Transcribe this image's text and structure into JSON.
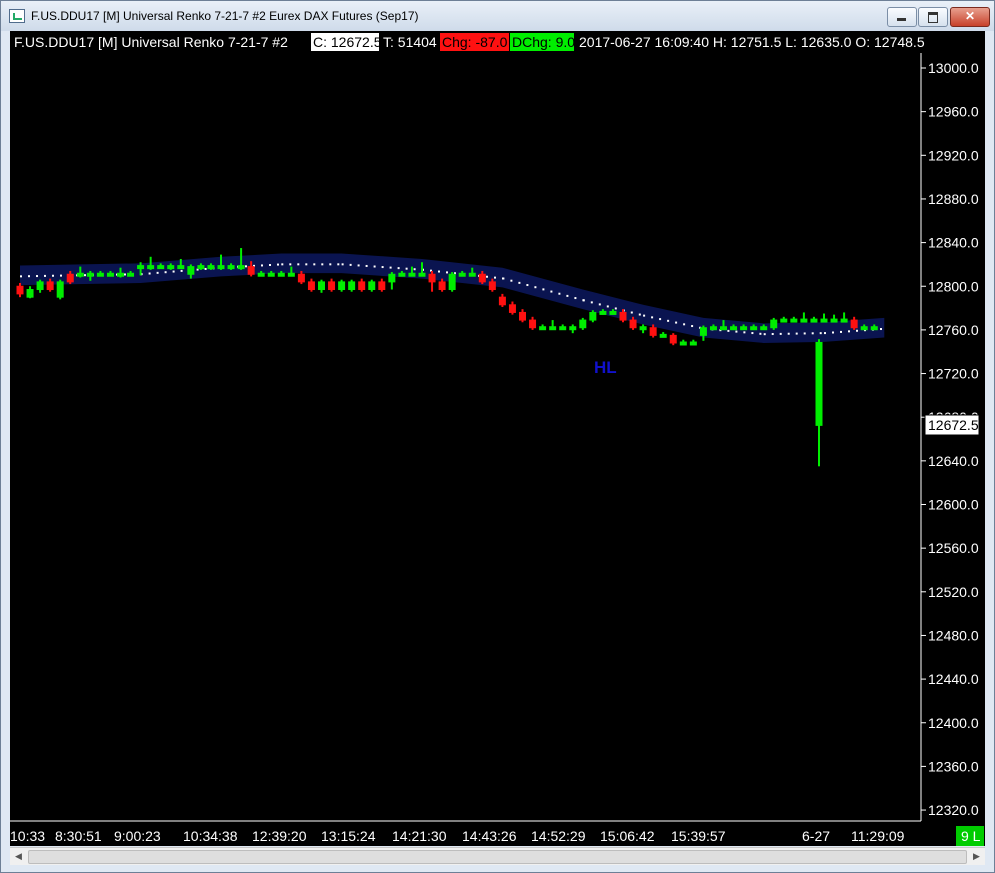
{
  "window": {
    "title": "F.US.DDU17 [M]  Universal Renko 7-21-7  #2  Eurex DAX Futures (Sep17)"
  },
  "header": {
    "symbol": "F.US.DDU17 [M]  Universal Renko 7-21-7  #2",
    "close": "C: 12672.5",
    "ticks": "T: 51404",
    "chg": "Chg: -87.0",
    "dchg": "DChg: 9.0",
    "ohlc": "2017-06-27 16:09:40 H: 12751.5 L: 12635.0 O: 12748.5"
  },
  "colors": {
    "background": "#000000",
    "up_bar": "#00ee00",
    "down_bar": "#ff1111",
    "band": "#0a1450",
    "band_dots": "#ffffff",
    "annotation": "#1111cc",
    "close_flag": "#00cc00"
  },
  "status": {
    "bar_count": "9 L"
  },
  "chart_data": {
    "type": "candlestick",
    "title": "",
    "ylim": [
      12300,
      13030
    ],
    "y_ticks": [
      "13000.0",
      "12960.0",
      "12920.0",
      "12880.0",
      "12840.0",
      "12800.0",
      "12760.0",
      "12720.0",
      "12680.0",
      "12640.0",
      "12600.0",
      "12560.0",
      "12520.0",
      "12480.0",
      "12440.0",
      "12400.0",
      "12360.0",
      "12320.0"
    ],
    "x_ticks": [
      "10:33",
      "8:30:51",
      "9:00:23",
      "10:34:38",
      "12:39:20",
      "13:15:24",
      "14:21:30",
      "14:43:26",
      "14:52:29",
      "15:06:42",
      "15:39:57",
      "6-27",
      "11:29:09"
    ],
    "current_price_label": "12672.5",
    "annotation": "HL",
    "grid": false,
    "bars": [
      {
        "o": 12800,
        "c": 12793,
        "h": 12803,
        "l": 12790
      },
      {
        "o": 12790,
        "c": 12797,
        "h": 12800,
        "l": 12789
      },
      {
        "o": 12797,
        "c": 12804,
        "h": 12806,
        "l": 12794
      },
      {
        "o": 12804,
        "c": 12797,
        "h": 12807,
        "l": 12795
      },
      {
        "o": 12790,
        "c": 12804,
        "h": 12806,
        "l": 12788
      },
      {
        "o": 12811,
        "c": 12804,
        "h": 12814,
        "l": 12802
      },
      {
        "o": 12811,
        "c": 12811,
        "h": 12818,
        "l": 12808
      },
      {
        "o": 12811,
        "c": 12811,
        "h": 12814,
        "l": 12805
      },
      {
        "o": 12811,
        "c": 12811,
        "h": 12814,
        "l": 12809
      },
      {
        "o": 12811,
        "c": 12811,
        "h": 12814,
        "l": 12809
      },
      {
        "o": 12811,
        "c": 12811,
        "h": 12817,
        "l": 12808
      },
      {
        "o": 12811,
        "c": 12811,
        "h": 12814,
        "l": 12809
      },
      {
        "o": 12818,
        "c": 12818,
        "h": 12822,
        "l": 12810
      },
      {
        "o": 12818,
        "c": 12818,
        "h": 12827,
        "l": 12815
      },
      {
        "o": 12818,
        "c": 12818,
        "h": 12821,
        "l": 12816
      },
      {
        "o": 12818,
        "c": 12818,
        "h": 12821,
        "l": 12815
      },
      {
        "o": 12818,
        "c": 12818,
        "h": 12825,
        "l": 12816
      },
      {
        "o": 12811,
        "c": 12818,
        "h": 12820,
        "l": 12807
      },
      {
        "o": 12818,
        "c": 12818,
        "h": 12821,
        "l": 12815
      },
      {
        "o": 12818,
        "c": 12818,
        "h": 12821,
        "l": 12815
      },
      {
        "o": 12818,
        "c": 12818,
        "h": 12829,
        "l": 12815
      },
      {
        "o": 12818,
        "c": 12818,
        "h": 12821,
        "l": 12815
      },
      {
        "o": 12818,
        "c": 12818,
        "h": 12835,
        "l": 12815
      },
      {
        "o": 12818,
        "c": 12811,
        "h": 12823,
        "l": 12809
      },
      {
        "o": 12811,
        "c": 12811,
        "h": 12814,
        "l": 12809
      },
      {
        "o": 12811,
        "c": 12811,
        "h": 12814,
        "l": 12809
      },
      {
        "o": 12811,
        "c": 12811,
        "h": 12814,
        "l": 12809
      },
      {
        "o": 12811,
        "c": 12811,
        "h": 12818,
        "l": 12809
      },
      {
        "o": 12811,
        "c": 12804,
        "h": 12814,
        "l": 12802
      },
      {
        "o": 12804,
        "c": 12797,
        "h": 12807,
        "l": 12795
      },
      {
        "o": 12797,
        "c": 12804,
        "h": 12806,
        "l": 12794
      },
      {
        "o": 12804,
        "c": 12797,
        "h": 12807,
        "l": 12795
      },
      {
        "o": 12797,
        "c": 12804,
        "h": 12806,
        "l": 12795
      },
      {
        "o": 12797,
        "c": 12804,
        "h": 12806,
        "l": 12795
      },
      {
        "o": 12804,
        "c": 12797,
        "h": 12807,
        "l": 12795
      },
      {
        "o": 12797,
        "c": 12804,
        "h": 12806,
        "l": 12795
      },
      {
        "o": 12804,
        "c": 12797,
        "h": 12807,
        "l": 12795
      },
      {
        "o": 12804,
        "c": 12811,
        "h": 12813,
        "l": 12797
      },
      {
        "o": 12811,
        "c": 12811,
        "h": 12814,
        "l": 12809
      },
      {
        "o": 12811,
        "c": 12811,
        "h": 12818,
        "l": 12809
      },
      {
        "o": 12811,
        "c": 12811,
        "h": 12822,
        "l": 12809
      },
      {
        "o": 12811,
        "c": 12804,
        "h": 12814,
        "l": 12795
      },
      {
        "o": 12804,
        "c": 12797,
        "h": 12807,
        "l": 12795
      },
      {
        "o": 12797,
        "c": 12811,
        "h": 12813,
        "l": 12795
      },
      {
        "o": 12811,
        "c": 12811,
        "h": 12814,
        "l": 12809
      },
      {
        "o": 12811,
        "c": 12811,
        "h": 12817,
        "l": 12809
      },
      {
        "o": 12811,
        "c": 12804,
        "h": 12814,
        "l": 12802
      },
      {
        "o": 12804,
        "c": 12797,
        "h": 12807,
        "l": 12795
      },
      {
        "o": 12790,
        "c": 12783,
        "h": 12793,
        "l": 12781
      },
      {
        "o": 12783,
        "c": 12776,
        "h": 12786,
        "l": 12774
      },
      {
        "o": 12776,
        "c": 12769,
        "h": 12779,
        "l": 12767
      },
      {
        "o": 12769,
        "c": 12762,
        "h": 12772,
        "l": 12760
      },
      {
        "o": 12762,
        "c": 12762,
        "h": 12765,
        "l": 12760
      },
      {
        "o": 12762,
        "c": 12762,
        "h": 12769,
        "l": 12760
      },
      {
        "o": 12762,
        "c": 12762,
        "h": 12765,
        "l": 12760
      },
      {
        "o": 12762,
        "c": 12762,
        "h": 12765,
        "l": 12757
      },
      {
        "o": 12762,
        "c": 12769,
        "h": 12771,
        "l": 12760
      },
      {
        "o": 12769,
        "c": 12776,
        "h": 12778,
        "l": 12767
      },
      {
        "o": 12776,
        "c": 12776,
        "h": 12779,
        "l": 12774
      },
      {
        "o": 12776,
        "c": 12776,
        "h": 12779,
        "l": 12774
      },
      {
        "o": 12776,
        "c": 12769,
        "h": 12779,
        "l": 12767
      },
      {
        "o": 12769,
        "c": 12762,
        "h": 12772,
        "l": 12760
      },
      {
        "o": 12762,
        "c": 12762,
        "h": 12765,
        "l": 12757
      },
      {
        "o": 12762,
        "c": 12755,
        "h": 12765,
        "l": 12753
      },
      {
        "o": 12755,
        "c": 12755,
        "h": 12758,
        "l": 12753
      },
      {
        "o": 12755,
        "c": 12748,
        "h": 12757,
        "l": 12746
      },
      {
        "o": 12748,
        "c": 12748,
        "h": 12751,
        "l": 12746
      },
      {
        "o": 12748,
        "c": 12748,
        "h": 12751,
        "l": 12746
      },
      {
        "o": 12755,
        "c": 12762,
        "h": 12764,
        "l": 12750
      },
      {
        "o": 12762,
        "c": 12762,
        "h": 12765,
        "l": 12760
      },
      {
        "o": 12762,
        "c": 12762,
        "h": 12769,
        "l": 12760
      },
      {
        "o": 12762,
        "c": 12762,
        "h": 12765,
        "l": 12760
      },
      {
        "o": 12762,
        "c": 12762,
        "h": 12765,
        "l": 12760
      },
      {
        "o": 12762,
        "c": 12762,
        "h": 12765,
        "l": 12760
      },
      {
        "o": 12762,
        "c": 12762,
        "h": 12765,
        "l": 12760
      },
      {
        "o": 12762,
        "c": 12769,
        "h": 12771,
        "l": 12760
      },
      {
        "o": 12769,
        "c": 12769,
        "h": 12772,
        "l": 12767
      },
      {
        "o": 12769,
        "c": 12769,
        "h": 12772,
        "l": 12767
      },
      {
        "o": 12769,
        "c": 12769,
        "h": 12776,
        "l": 12767
      },
      {
        "o": 12769,
        "c": 12769,
        "h": 12772,
        "l": 12767
      },
      {
        "o": 12769,
        "c": 12769,
        "h": 12775,
        "l": 12767
      },
      {
        "o": 12769,
        "c": 12769,
        "h": 12774,
        "l": 12767
      },
      {
        "o": 12769,
        "c": 12769,
        "h": 12776,
        "l": 12767
      },
      {
        "o": 12769,
        "c": 12762,
        "h": 12772,
        "l": 12760
      },
      {
        "o": 12762,
        "c": 12762,
        "h": 12765,
        "l": 12760
      },
      {
        "o": 12762,
        "c": 12762,
        "h": 12765,
        "l": 12760
      },
      {
        "o": 12672.5,
        "c": 12748.5,
        "h": 12751.5,
        "l": 12635
      }
    ],
    "band_center": [
      {
        "x": 0,
        "y": 12810
      },
      {
        "x": 12,
        "y": 12812
      },
      {
        "x": 20,
        "y": 12818
      },
      {
        "x": 26,
        "y": 12821
      },
      {
        "x": 32,
        "y": 12821
      },
      {
        "x": 40,
        "y": 12816
      },
      {
        "x": 48,
        "y": 12808
      },
      {
        "x": 56,
        "y": 12788
      },
      {
        "x": 62,
        "y": 12774
      },
      {
        "x": 68,
        "y": 12762
      },
      {
        "x": 74,
        "y": 12757
      },
      {
        "x": 80,
        "y": 12758
      },
      {
        "x": 86,
        "y": 12762
      }
    ],
    "band_half_width": 9
  }
}
